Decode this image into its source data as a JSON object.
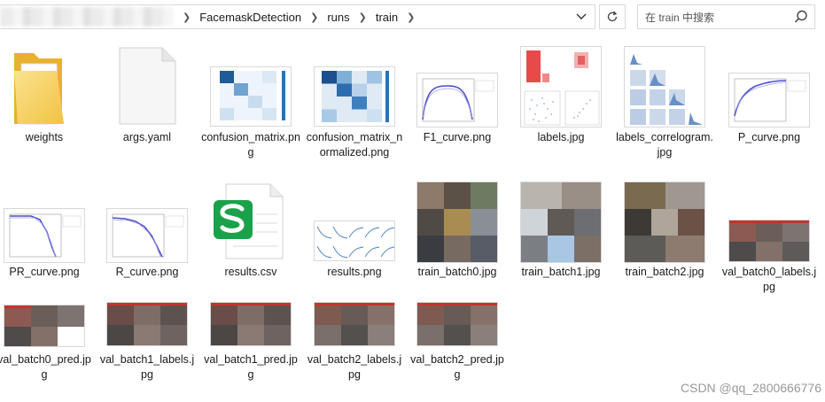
{
  "breadcrumb": {
    "items": [
      "FacemaskDetection",
      "runs",
      "train"
    ]
  },
  "search": {
    "placeholder": "在 train 中搜索"
  },
  "files": [
    {
      "name": "weights",
      "icon": "folder-icon"
    },
    {
      "name": "args.yaml",
      "icon": "document-icon"
    },
    {
      "name": "confusion_matrix.png",
      "icon": "image-thumbnail"
    },
    {
      "name": "confusion_matrix_normalized.png",
      "icon": "image-thumbnail"
    },
    {
      "name": "F1_curve.png",
      "icon": "image-thumbnail"
    },
    {
      "name": "labels.jpg",
      "icon": "image-thumbnail"
    },
    {
      "name": "labels_correlogram.jpg",
      "icon": "image-thumbnail"
    },
    {
      "name": "P_curve.png",
      "icon": "image-thumbnail"
    },
    {
      "name": "PR_curve.png",
      "icon": "image-thumbnail"
    },
    {
      "name": "R_curve.png",
      "icon": "image-thumbnail"
    },
    {
      "name": "results.csv",
      "icon": "spreadsheet-icon"
    },
    {
      "name": "results.png",
      "icon": "image-thumbnail"
    },
    {
      "name": "train_batch0.jpg",
      "icon": "image-thumbnail"
    },
    {
      "name": "train_batch1.jpg",
      "icon": "image-thumbnail"
    },
    {
      "name": "train_batch2.jpg",
      "icon": "image-thumbnail"
    },
    {
      "name": "val_batch0_labels.jpg",
      "icon": "image-thumbnail"
    },
    {
      "name": "val_batch0_pred.jpg",
      "icon": "image-thumbnail"
    },
    {
      "name": "val_batch1_labels.jpg",
      "icon": "image-thumbnail"
    },
    {
      "name": "val_batch1_pred.jpg",
      "icon": "image-thumbnail"
    },
    {
      "name": "val_batch2_labels.jpg",
      "icon": "image-thumbnail"
    },
    {
      "name": "val_batch2_pred.jpg",
      "icon": "image-thumbnail"
    }
  ],
  "watermark": "CSDN @qq_2800666776",
  "colors": {
    "folder": "#f3c341",
    "wps_green": "#1aa24a",
    "cm_blue": "#1f5a99"
  }
}
